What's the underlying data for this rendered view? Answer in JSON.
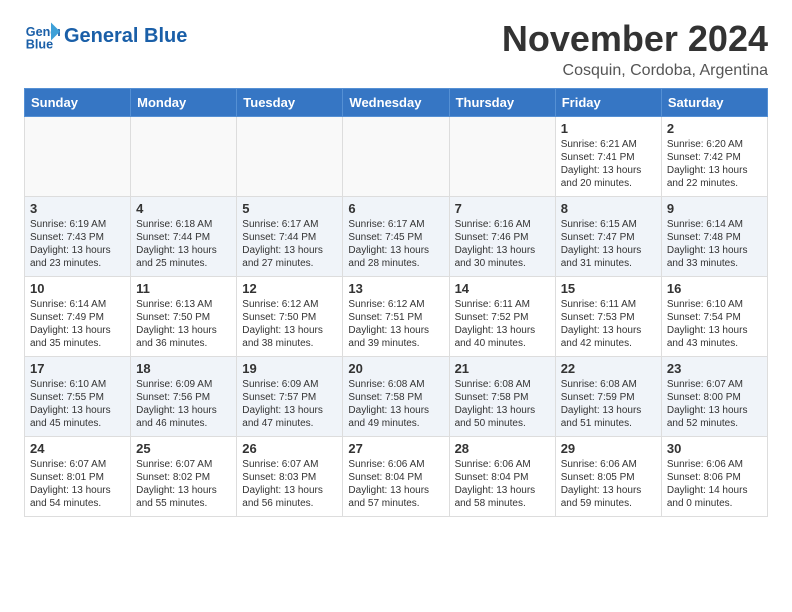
{
  "header": {
    "logo_line1": "General",
    "logo_line2": "Blue",
    "month_title": "November 2024",
    "location": "Cosquin, Cordoba, Argentina"
  },
  "days_of_week": [
    "Sunday",
    "Monday",
    "Tuesday",
    "Wednesday",
    "Thursday",
    "Friday",
    "Saturday"
  ],
  "weeks": [
    [
      {
        "day": "",
        "info": ""
      },
      {
        "day": "",
        "info": ""
      },
      {
        "day": "",
        "info": ""
      },
      {
        "day": "",
        "info": ""
      },
      {
        "day": "",
        "info": ""
      },
      {
        "day": "1",
        "info": "Sunrise: 6:21 AM\nSunset: 7:41 PM\nDaylight: 13 hours\nand 20 minutes."
      },
      {
        "day": "2",
        "info": "Sunrise: 6:20 AM\nSunset: 7:42 PM\nDaylight: 13 hours\nand 22 minutes."
      }
    ],
    [
      {
        "day": "3",
        "info": "Sunrise: 6:19 AM\nSunset: 7:43 PM\nDaylight: 13 hours\nand 23 minutes."
      },
      {
        "day": "4",
        "info": "Sunrise: 6:18 AM\nSunset: 7:44 PM\nDaylight: 13 hours\nand 25 minutes."
      },
      {
        "day": "5",
        "info": "Sunrise: 6:17 AM\nSunset: 7:44 PM\nDaylight: 13 hours\nand 27 minutes."
      },
      {
        "day": "6",
        "info": "Sunrise: 6:17 AM\nSunset: 7:45 PM\nDaylight: 13 hours\nand 28 minutes."
      },
      {
        "day": "7",
        "info": "Sunrise: 6:16 AM\nSunset: 7:46 PM\nDaylight: 13 hours\nand 30 minutes."
      },
      {
        "day": "8",
        "info": "Sunrise: 6:15 AM\nSunset: 7:47 PM\nDaylight: 13 hours\nand 31 minutes."
      },
      {
        "day": "9",
        "info": "Sunrise: 6:14 AM\nSunset: 7:48 PM\nDaylight: 13 hours\nand 33 minutes."
      }
    ],
    [
      {
        "day": "10",
        "info": "Sunrise: 6:14 AM\nSunset: 7:49 PM\nDaylight: 13 hours\nand 35 minutes."
      },
      {
        "day": "11",
        "info": "Sunrise: 6:13 AM\nSunset: 7:50 PM\nDaylight: 13 hours\nand 36 minutes."
      },
      {
        "day": "12",
        "info": "Sunrise: 6:12 AM\nSunset: 7:50 PM\nDaylight: 13 hours\nand 38 minutes."
      },
      {
        "day": "13",
        "info": "Sunrise: 6:12 AM\nSunset: 7:51 PM\nDaylight: 13 hours\nand 39 minutes."
      },
      {
        "day": "14",
        "info": "Sunrise: 6:11 AM\nSunset: 7:52 PM\nDaylight: 13 hours\nand 40 minutes."
      },
      {
        "day": "15",
        "info": "Sunrise: 6:11 AM\nSunset: 7:53 PM\nDaylight: 13 hours\nand 42 minutes."
      },
      {
        "day": "16",
        "info": "Sunrise: 6:10 AM\nSunset: 7:54 PM\nDaylight: 13 hours\nand 43 minutes."
      }
    ],
    [
      {
        "day": "17",
        "info": "Sunrise: 6:10 AM\nSunset: 7:55 PM\nDaylight: 13 hours\nand 45 minutes."
      },
      {
        "day": "18",
        "info": "Sunrise: 6:09 AM\nSunset: 7:56 PM\nDaylight: 13 hours\nand 46 minutes."
      },
      {
        "day": "19",
        "info": "Sunrise: 6:09 AM\nSunset: 7:57 PM\nDaylight: 13 hours\nand 47 minutes."
      },
      {
        "day": "20",
        "info": "Sunrise: 6:08 AM\nSunset: 7:58 PM\nDaylight: 13 hours\nand 49 minutes."
      },
      {
        "day": "21",
        "info": "Sunrise: 6:08 AM\nSunset: 7:58 PM\nDaylight: 13 hours\nand 50 minutes."
      },
      {
        "day": "22",
        "info": "Sunrise: 6:08 AM\nSunset: 7:59 PM\nDaylight: 13 hours\nand 51 minutes."
      },
      {
        "day": "23",
        "info": "Sunrise: 6:07 AM\nSunset: 8:00 PM\nDaylight: 13 hours\nand 52 minutes."
      }
    ],
    [
      {
        "day": "24",
        "info": "Sunrise: 6:07 AM\nSunset: 8:01 PM\nDaylight: 13 hours\nand 54 minutes."
      },
      {
        "day": "25",
        "info": "Sunrise: 6:07 AM\nSunset: 8:02 PM\nDaylight: 13 hours\nand 55 minutes."
      },
      {
        "day": "26",
        "info": "Sunrise: 6:07 AM\nSunset: 8:03 PM\nDaylight: 13 hours\nand 56 minutes."
      },
      {
        "day": "27",
        "info": "Sunrise: 6:06 AM\nSunset: 8:04 PM\nDaylight: 13 hours\nand 57 minutes."
      },
      {
        "day": "28",
        "info": "Sunrise: 6:06 AM\nSunset: 8:04 PM\nDaylight: 13 hours\nand 58 minutes."
      },
      {
        "day": "29",
        "info": "Sunrise: 6:06 AM\nSunset: 8:05 PM\nDaylight: 13 hours\nand 59 minutes."
      },
      {
        "day": "30",
        "info": "Sunrise: 6:06 AM\nSunset: 8:06 PM\nDaylight: 14 hours\nand 0 minutes."
      }
    ]
  ]
}
